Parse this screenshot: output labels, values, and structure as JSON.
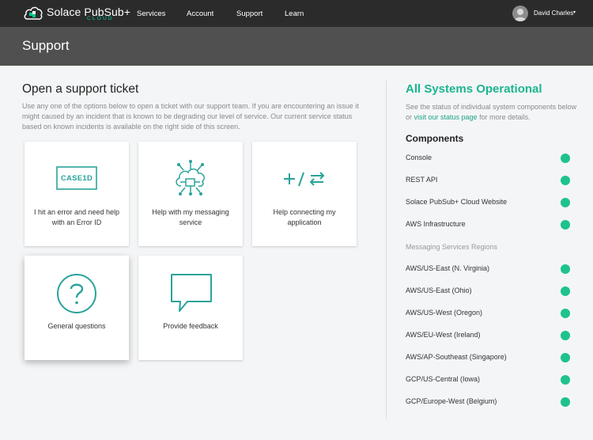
{
  "brand": {
    "name": "Solace PubSub+",
    "sub": "CLOUD",
    "accent": "#00c895"
  },
  "nav": {
    "items": [
      "Services",
      "Account",
      "Support",
      "Learn"
    ]
  },
  "user": {
    "name": "David Charles",
    "caret": "▾"
  },
  "header": {
    "title": "Support"
  },
  "ticket": {
    "title": "Open a support ticket",
    "intro": "Use any one of the options below to open a ticket with our support team. If you are encountering an issue it might caused by an incident that is known to be degrading our level of service. Our current service status based on known incidents is available on the right side of this screen.",
    "options": [
      {
        "label": "I hit an error and need help with an Error ID",
        "icon": "case-id-icon",
        "badge": "CASE1D"
      },
      {
        "label": "Help with my messaging service",
        "icon": "cloud-network-icon"
      },
      {
        "label": "Help connecting my application",
        "icon": "plus-slash-swap-icon"
      },
      {
        "label": "General questions",
        "icon": "question-circle-icon"
      },
      {
        "label": "Provide feedback",
        "icon": "speech-bubble-icon"
      }
    ]
  },
  "status": {
    "title": "All Systems Operational",
    "text_before": "See the status of individual system components below or ",
    "link": "visit our status page",
    "text_after": " for more details.",
    "components_title": "Components",
    "components": [
      "Console",
      "REST API",
      "Solace PubSub+ Cloud Website",
      "AWS Infrastructure"
    ],
    "regions_title": "Messaging Services Regions",
    "regions": [
      "AWS/US-East (N. Virginia)",
      "AWS/US-East (Ohio)",
      "AWS/US-West (Oregon)",
      "AWS/EU-West (Ireland)",
      "AWS/AP-Southeast (Singapore)",
      "GCP/US-Central (Iowa)",
      "GCP/Europe-West (Belgium)"
    ],
    "ok_color": "#1dc28f"
  },
  "icon_color": "#2aa39a"
}
